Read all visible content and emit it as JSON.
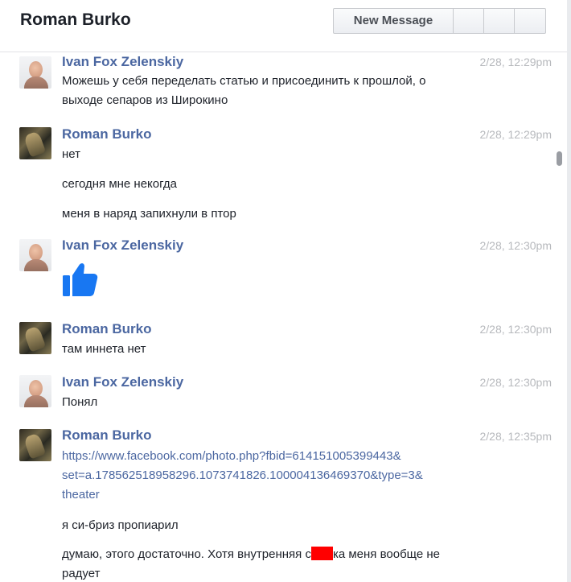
{
  "header": {
    "title": "Roman Burko",
    "new_message_label": "New Message"
  },
  "messages": [
    {
      "sender": "Ivan Fox Zelenskiy",
      "time": "2/28, 12:29pm",
      "lines": [
        "Можешь у себя переделать статью и присоединить к прошлой, о",
        "выходе сепаров из Широкино"
      ]
    },
    {
      "sender": "Roman Burko",
      "time": "2/28, 12:29pm",
      "lines": [
        "нет",
        "сегодня мне некогда",
        "меня в наряд запихнули в птор"
      ]
    },
    {
      "sender": "Ivan Fox Zelenskiy",
      "time": "2/28, 12:30pm",
      "icon": "thumbs-up-icon"
    },
    {
      "sender": "Roman Burko",
      "time": "2/28, 12:30pm",
      "lines": [
        "там иннета нет"
      ]
    },
    {
      "sender": "Ivan Fox Zelenskiy",
      "time": "2/28, 12:30pm",
      "lines": [
        "Понял"
      ]
    },
    {
      "sender": "Roman Burko",
      "time": "2/28, 12:35pm",
      "link_lines": [
        "https://www.facebook.com/photo.php?fbid=614151005399443&",
        "set=a.178562518958296.1073741826.100004136469370&type=3&",
        "theater"
      ],
      "lines": [
        "я си-бриз пропиарил"
      ],
      "last_line_a": "думаю, этого достаточно. Хотя внутренняя с",
      "last_line_b": "ка меня вообще не",
      "last_line_c": "радует"
    }
  ],
  "colors": {
    "sender": "#4b67a1",
    "time": "#b7b9bd",
    "like": "#1877f2",
    "redaction": "#ff0000"
  }
}
